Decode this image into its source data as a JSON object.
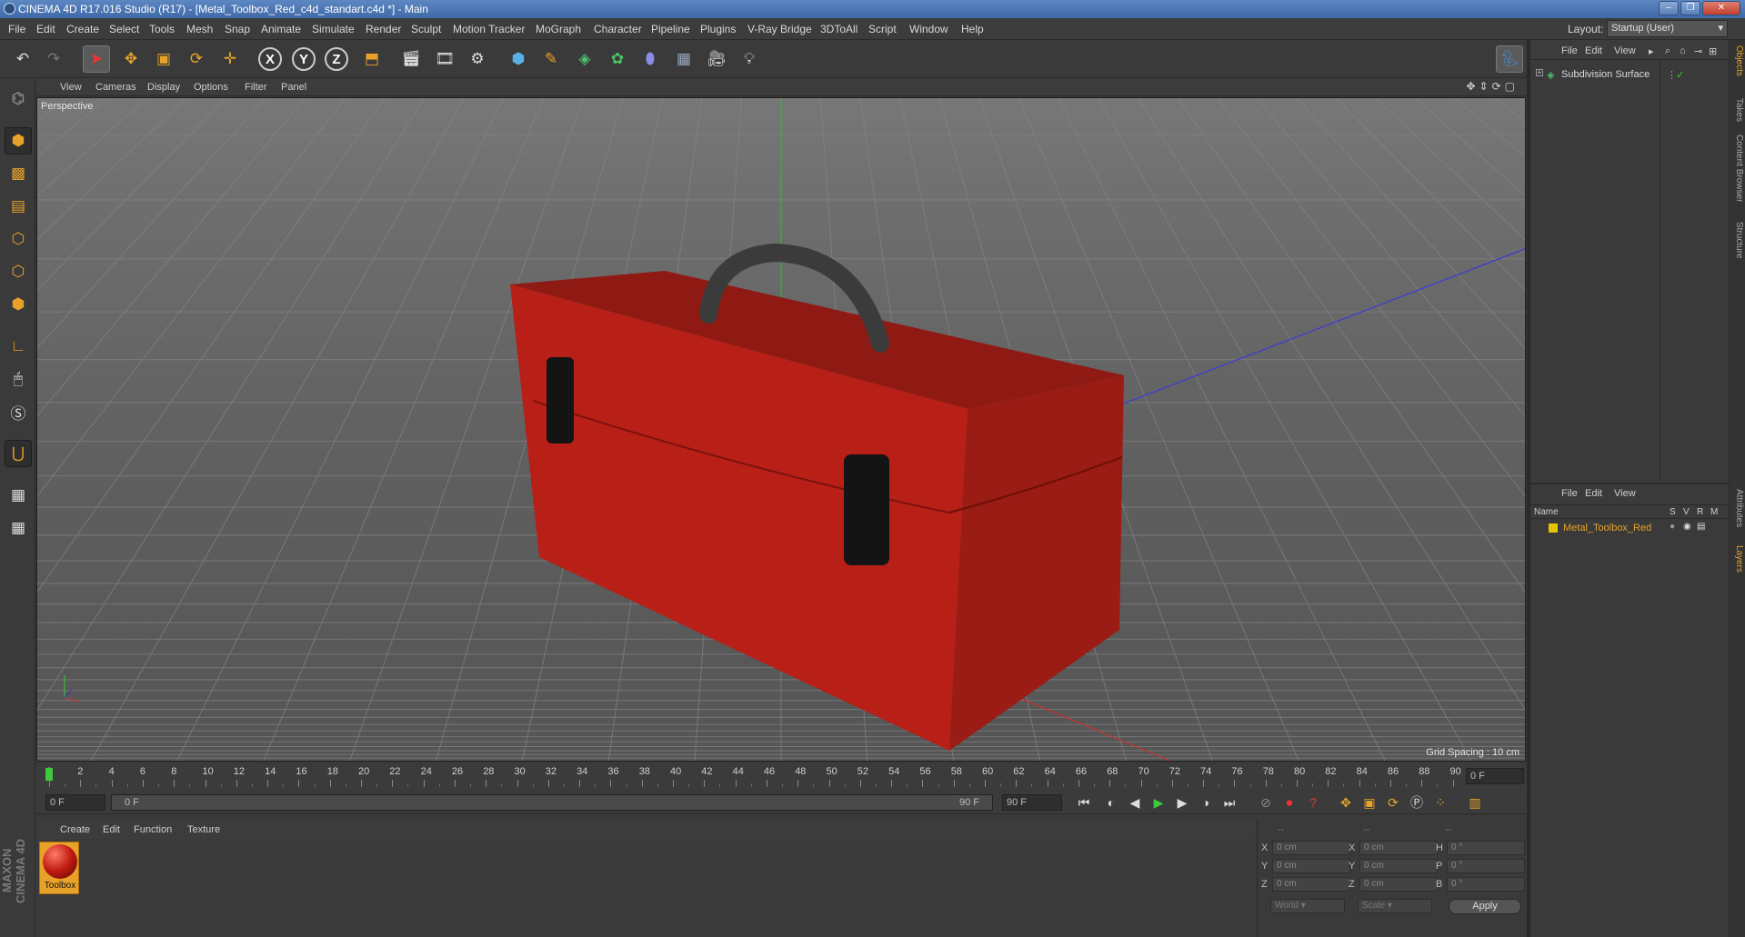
{
  "window": {
    "title": "CINEMA 4D R17.016 Studio (R17) - [Metal_Toolbox_Red_c4d_standart.c4d *] - Main",
    "buttons": [
      "–",
      "❐",
      "✕"
    ]
  },
  "menu": {
    "items": [
      "File",
      "Edit",
      "Create",
      "Select",
      "Tools",
      "Mesh",
      "Snap",
      "Animate",
      "Simulate",
      "Render",
      "Sculpt",
      "Motion Tracker",
      "MoGraph",
      "Character",
      "Pipeline",
      "Plugins",
      "V-Ray Bridge",
      "3DToAll",
      "Script",
      "Window",
      "Help"
    ],
    "layout_label": "Layout:",
    "layout_value": "Startup (User)"
  },
  "toolbar": {
    "axis_labels": [
      "X",
      "Y",
      "Z"
    ]
  },
  "viewport": {
    "menu": [
      "View",
      "Cameras",
      "Display",
      "Options",
      "Filter",
      "Panel"
    ],
    "label": "Perspective",
    "grid_spacing": "Grid Spacing : 10 cm",
    "axis_x_color": "#c83232",
    "axis_y_color": "#2eb82e",
    "axis_z_color": "#3a3ad8",
    "object_color": "#b81f17"
  },
  "timeline": {
    "ticks": [
      "0",
      "2",
      "4",
      "6",
      "8",
      "10",
      "12",
      "14",
      "16",
      "18",
      "20",
      "22",
      "24",
      "26",
      "28",
      "30",
      "32",
      "34",
      "36",
      "38",
      "40",
      "42",
      "44",
      "46",
      "48",
      "50",
      "52",
      "54",
      "56",
      "58",
      "60",
      "62",
      "64",
      "66",
      "68",
      "70",
      "72",
      "74",
      "76",
      "78",
      "80",
      "82",
      "84",
      "86",
      "88",
      "90"
    ],
    "current_frame_field": "0 F"
  },
  "playback": {
    "start_field": "0 F",
    "range_start": "0 F",
    "range_end": "90 F",
    "end_field": "90 F"
  },
  "material": {
    "menu": [
      "Create",
      "Edit",
      "Function",
      "Texture"
    ],
    "name": "Toolbox"
  },
  "coords": {
    "header": [
      "--",
      "--",
      "--"
    ],
    "rows": [
      {
        "l1": "X",
        "v1": "0 cm",
        "l2": "X",
        "v2": "0 cm",
        "l3": "H",
        "v3": "0 °"
      },
      {
        "l1": "Y",
        "v1": "0 cm",
        "l2": "Y",
        "v2": "0 cm",
        "l3": "P",
        "v3": "0 °"
      },
      {
        "l1": "Z",
        "v1": "0 cm",
        "l2": "Z",
        "v2": "0 cm",
        "l3": "B",
        "v3": "0 °"
      }
    ],
    "mode": "World",
    "size_mode": "Scale",
    "apply": "Apply"
  },
  "objects": {
    "menu": [
      "File",
      "Edit",
      "View"
    ],
    "items": [
      {
        "name": "Subdivision Surface"
      }
    ]
  },
  "layers": {
    "menu": [
      "File",
      "Edit",
      "View"
    ],
    "columns": {
      "name": "Name",
      "s": "S",
      "v": "V",
      "r": "R",
      "m": "M"
    },
    "items": [
      {
        "name": "Metal_Toolbox_Red",
        "color": "#e8c300"
      }
    ]
  },
  "side_tabs": [
    "Objects",
    "Takes",
    "Content Browser",
    "Structure",
    "Attributes",
    "Layers"
  ],
  "brand": "MAXON CINEMA 4D"
}
